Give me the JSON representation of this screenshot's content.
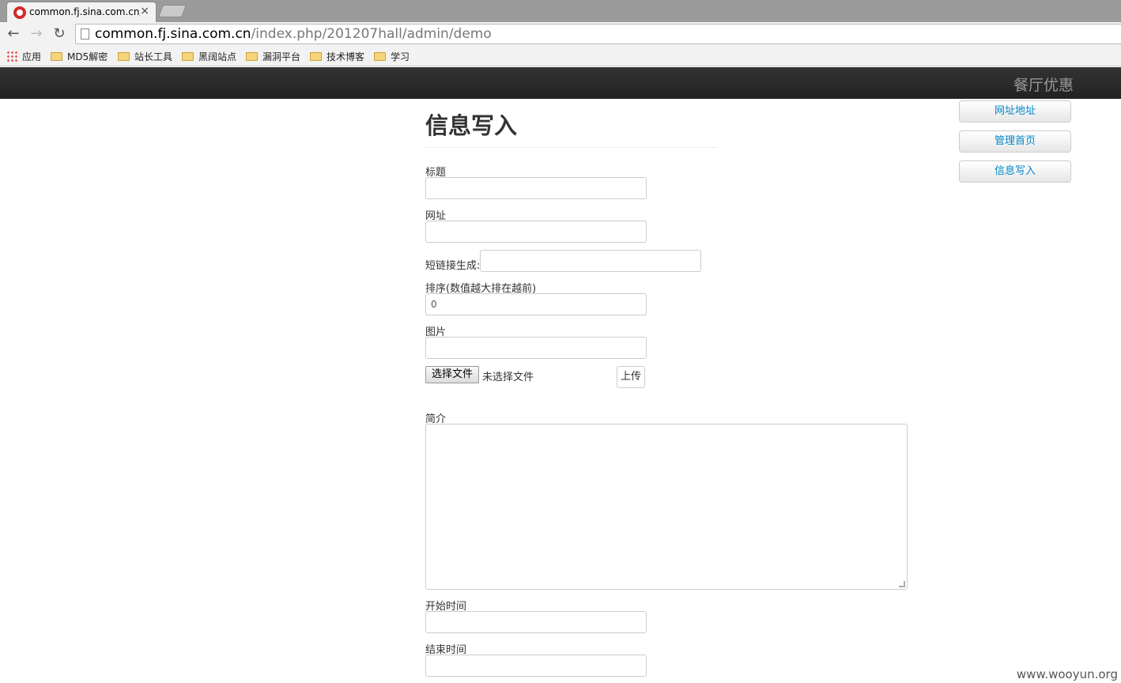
{
  "browser": {
    "tab_title": "common.fj.sina.com.cn/",
    "tab_close": "×",
    "back": "←",
    "forward": "→",
    "reload": "↻",
    "url_host": "common.fj.sina.com.cn",
    "url_path": "/index.php/201207hall/admin/demo",
    "bookmarks": [
      "应用",
      "MD5解密",
      "站长工具",
      "黑阔站点",
      "漏洞平台",
      "技术博客",
      "学习"
    ]
  },
  "navbar": {
    "brand": "餐厅优惠"
  },
  "sidebar": {
    "items": [
      "网址地址",
      "管理首页",
      "信息写入"
    ]
  },
  "form": {
    "title": "信息写入",
    "label_title": "标题",
    "label_url": "网址",
    "label_shortlink": "短链接生成:",
    "label_order": "排序(数值越大排在越前)",
    "order_value": "0",
    "label_image": "图片",
    "file_button": "选择文件",
    "file_status": "未选择文件",
    "upload_button": "上传",
    "label_intro": "简介",
    "label_start": "开始时间",
    "label_end": "结束时间"
  },
  "watermark": "www.wooyun.org"
}
